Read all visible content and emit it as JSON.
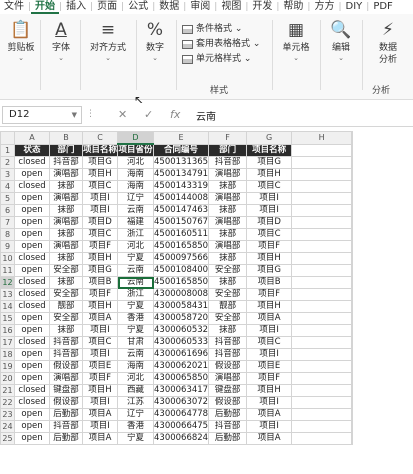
{
  "tabs": [
    "文件",
    "开始",
    "插入",
    "页面",
    "公式",
    "数据",
    "审阅",
    "视图",
    "开发",
    "帮助",
    "方方",
    "DIY",
    "PDF"
  ],
  "active_tab": "开始",
  "ribbon": {
    "clipboard": "剪贴板",
    "font": "字体",
    "alignment": "对齐方式",
    "number": "数字",
    "conditional_format": "条件格式",
    "table_format": "套用表格格式",
    "cell_style": "单元格样式",
    "styles_group": "样式",
    "cells": "单元格",
    "editing": "编辑",
    "analyze1": "数据",
    "analyze2": "分析",
    "analysis_group": "分析"
  },
  "formula_bar": {
    "name_box": "D12",
    "value": "云南"
  },
  "columns": [
    "A",
    "B",
    "C",
    "D",
    "E",
    "F",
    "G",
    "H"
  ],
  "selected_column": "D",
  "selected_row": 12,
  "header_row": [
    "状态",
    "部门",
    "项目名称",
    "项目省份",
    "合同编号",
    "部门",
    "项目名称"
  ],
  "rows": [
    [
      "closed",
      "抖音部",
      "项目G",
      "河北",
      "4500131365",
      "抖音部",
      "项目G"
    ],
    [
      "open",
      "演唱部",
      "项目H",
      "海南",
      "4500134791",
      "演唱部",
      "项目H"
    ],
    [
      "closed",
      "抹部",
      "项目C",
      "海南",
      "4500143319",
      "抹部",
      "项目C"
    ],
    [
      "open",
      "演唱部",
      "项目I",
      "辽宁",
      "4500144008",
      "演唱部",
      "项目I"
    ],
    [
      "open",
      "抹部",
      "项目I",
      "云南",
      "4500147463",
      "抹部",
      "项目I"
    ],
    [
      "open",
      "演唱部",
      "项目D",
      "福建",
      "4500150767",
      "演唱部",
      "项目D"
    ],
    [
      "open",
      "抹部",
      "项目C",
      "浙江",
      "4500160511",
      "抹部",
      "项目C"
    ],
    [
      "open",
      "演唱部",
      "项目F",
      "河北",
      "4500165850",
      "演唱部",
      "项目F"
    ],
    [
      "closed",
      "抹部",
      "项目H",
      "宁夏",
      "4500097566",
      "抹部",
      "项目H"
    ],
    [
      "open",
      "安全部",
      "项目G",
      "云南",
      "4500108400",
      "安全部",
      "项目G"
    ],
    [
      "closed",
      "抹部",
      "项目B",
      "云南",
      "4500165850",
      "抹部",
      "项目B"
    ],
    [
      "closed",
      "安全部",
      "项目F",
      "浙江",
      "4300008008",
      "安全部",
      "项目F"
    ],
    [
      "closed",
      "靓部",
      "项目H",
      "宁夏",
      "4300058431",
      "靓部",
      "项目H"
    ],
    [
      "open",
      "安全部",
      "项目A",
      "香港",
      "4300058720",
      "安全部",
      "项目A"
    ],
    [
      "open",
      "抹部",
      "项目I",
      "宁夏",
      "4300060532",
      "抹部",
      "项目I"
    ],
    [
      "closed",
      "抖音部",
      "项目C",
      "甘肃",
      "4300060533",
      "抖音部",
      "项目C"
    ],
    [
      "open",
      "抖音部",
      "项目I",
      "云南",
      "4300061696",
      "抖音部",
      "项目I"
    ],
    [
      "open",
      "假设部",
      "项目E",
      "海南",
      "4300062021",
      "假设部",
      "项目E"
    ],
    [
      "open",
      "演唱部",
      "项目F",
      "河北",
      "4300065850",
      "演唱部",
      "项目F"
    ],
    [
      "closed",
      "键盘部",
      "项目H",
      "西藏",
      "4300063417",
      "键盘部",
      "项目H"
    ],
    [
      "closed",
      "假设部",
      "项目I",
      "江苏",
      "4300063072",
      "假设部",
      "项目I"
    ],
    [
      "open",
      "后勤部",
      "项目A",
      "辽宁",
      "4300064778",
      "后勤部",
      "项目A"
    ],
    [
      "open",
      "抖音部",
      "项目I",
      "香港",
      "4300066475",
      "抖音部",
      "项目I"
    ],
    [
      "open",
      "后勤部",
      "项目A",
      "宁夏",
      "4300066824",
      "后勤部",
      "项目A"
    ]
  ]
}
